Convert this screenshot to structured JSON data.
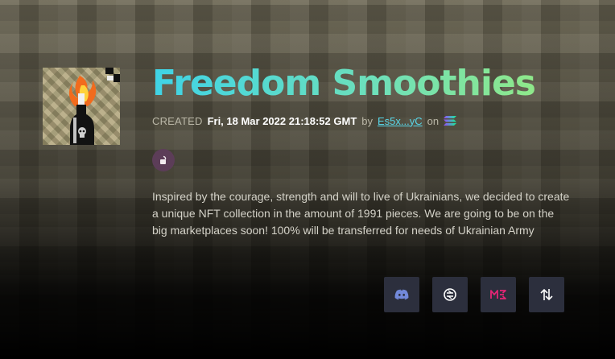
{
  "collection": {
    "title": "Freedom Smoothies",
    "created_label": "CREATED",
    "created_date": "Fri, 18 Mar 2022 21:18:52 GMT",
    "by_label": "by",
    "owner": "Es5x...yC",
    "on_label": "on",
    "chain_icon": "solana-icon",
    "lock_icon": "unlock-icon",
    "description": "Inspired by the courage, strength and will to live of Ukrainians, we decided to create a unique NFT collection in the amount of 1991 pieces. We are going to be on the big marketplaces soon! 100% will be transferred for needs of Ukrainian Army"
  },
  "links": [
    {
      "icon": "discord-icon",
      "color": "#7289da"
    },
    {
      "icon": "solscan-icon",
      "color": "#ffffff"
    },
    {
      "icon": "magic-eden-icon",
      "color": "#e42575"
    },
    {
      "icon": "swap-icon",
      "color": "#ffffff"
    }
  ],
  "colors": {
    "title_gradient_start": "#3fd3e6",
    "title_gradient_end": "#8fe88a",
    "owner_link": "#58d6e8",
    "button_bg": "#2c2f3d",
    "lock_badge_bg": "#5c3d58"
  }
}
